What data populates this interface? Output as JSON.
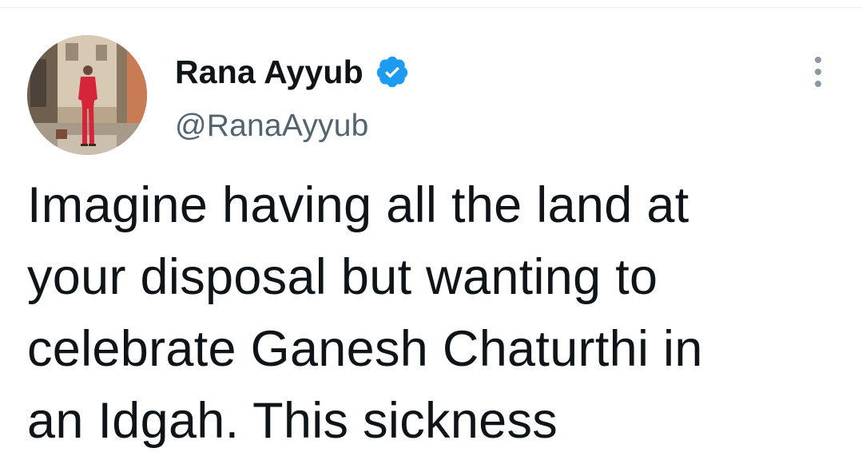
{
  "author": {
    "display_name": "Rana Ayyub",
    "handle": "@RanaAyyub",
    "verified": true,
    "avatar_icon": "profile-photo",
    "verified_icon": "verified-badge-icon",
    "verified_color": "#1d9bf0"
  },
  "tweet": {
    "text": "Imagine having all the land at\nyour disposal but wanting to\ncelebrate Ganesh Chaturthi in\nan Idgah. This sickness"
  },
  "menu": {
    "icon": "more-options-icon"
  },
  "colors": {
    "text_primary": "#0f1419",
    "text_secondary": "#536471",
    "accent": "#1d9bf0"
  }
}
